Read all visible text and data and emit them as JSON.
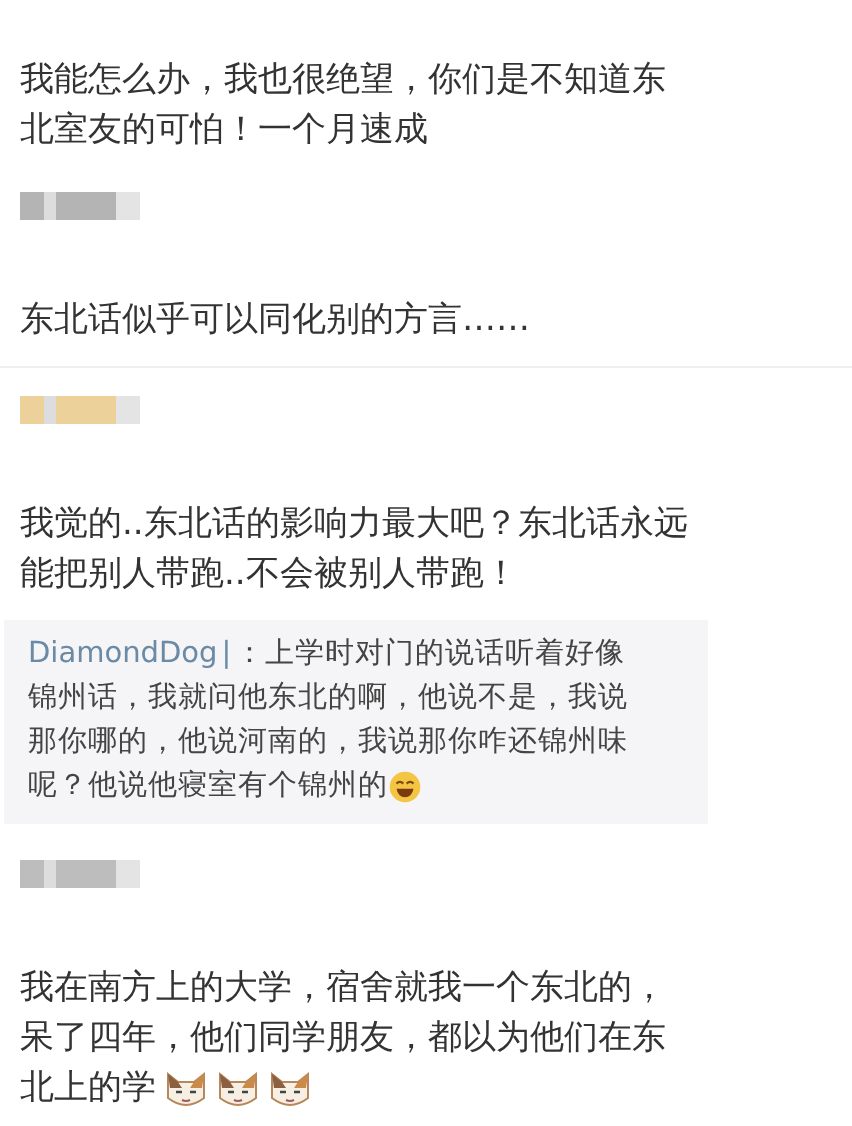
{
  "posts": [
    {
      "lines": [
        "我能怎么办，我也很绝望，你们是不知道东",
        "北室友的可怕！一个月速成"
      ]
    },
    {
      "color": "#b4b4b4",
      "lines": [
        "东北话似乎可以同化别的方言……"
      ]
    },
    {
      "color": "#ecd29a",
      "lines": [
        "我觉的..东北话的影响力最大吧？东北话永远",
        "能把别人带跑..不会被别人带跑！"
      ],
      "quote": {
        "author": "DiamondDog",
        "separator": "|",
        "lines": [
          "：上学时对门的说话听着好像",
          "锦州话，我就问他东北的啊，他说不是，我说",
          "那你哪的，他说河南的，我说那你咋还锦州味",
          "呢？他说他寝室有个锦州的"
        ],
        "emojis": [
          {
            "kind": "laugh"
          }
        ]
      }
    },
    {
      "color": "#bdbdbd",
      "lines": [
        "我在南方上的大学，宿舍就我一个东北的，",
        "呆了四年，他们同学朋友，都以为他们在东",
        "北上的学"
      ],
      "emojis": [
        {
          "kind": "cat"
        },
        {
          "kind": "cat"
        },
        {
          "kind": "cat"
        }
      ]
    }
  ]
}
